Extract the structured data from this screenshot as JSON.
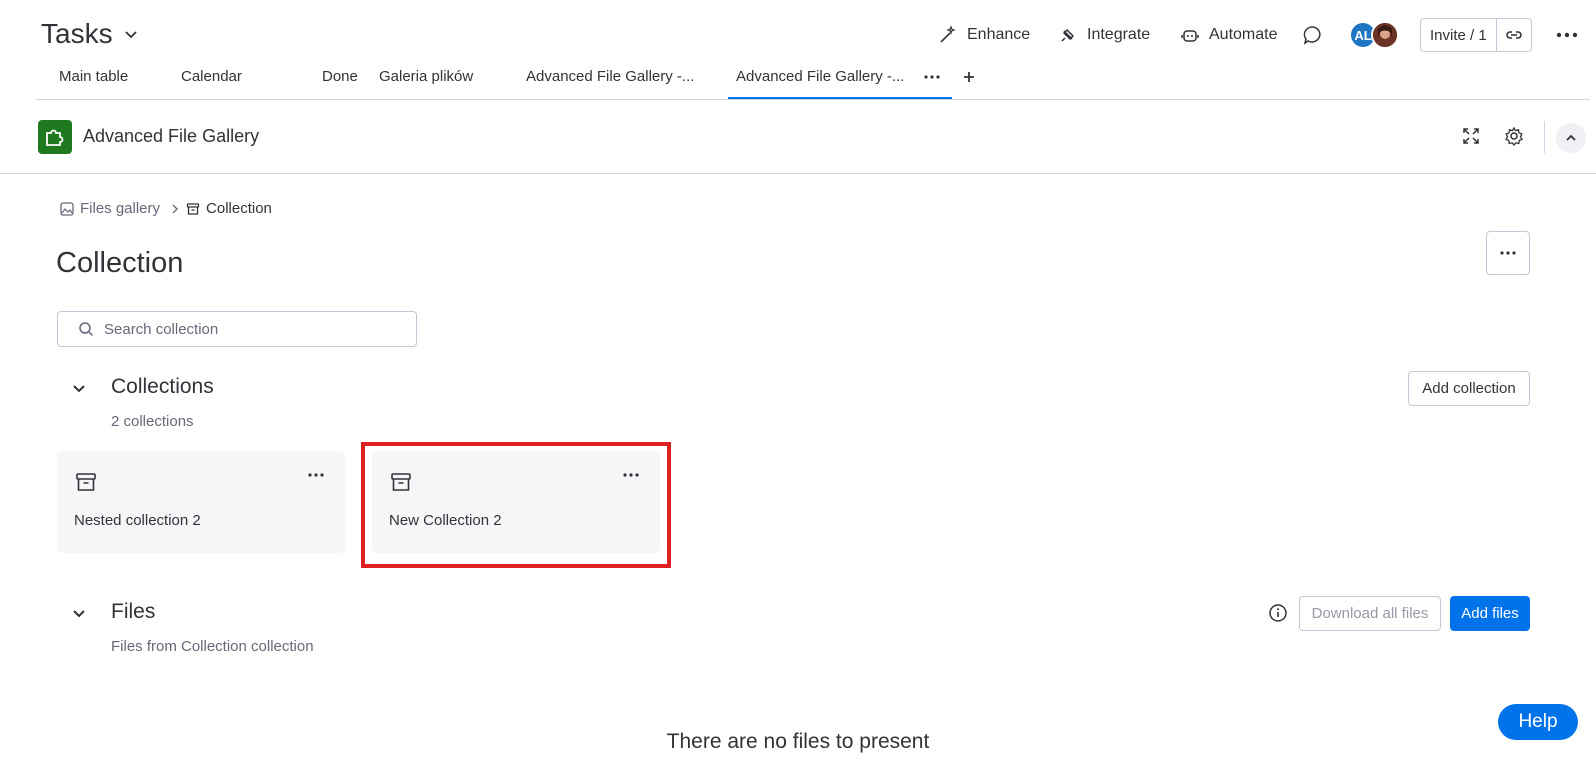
{
  "board": {
    "title": "Tasks"
  },
  "header": {
    "enhance": "Enhance",
    "integrate": "Integrate",
    "automate": "Automate",
    "avatar_initials": "AL",
    "invite_label": "Invite / 1"
  },
  "tabs": [
    {
      "label": "Main table"
    },
    {
      "label": "Calendar"
    },
    {
      "label": "Done"
    },
    {
      "label": "Galeria plików"
    },
    {
      "label": "Advanced File Gallery -..."
    },
    {
      "label": "Advanced File Gallery -...",
      "active": true
    }
  ],
  "app": {
    "name": "Advanced File Gallery"
  },
  "breadcrumb": {
    "root": "Files gallery",
    "current": "Collection"
  },
  "page": {
    "title": "Collection"
  },
  "search": {
    "placeholder": "Search collection"
  },
  "collections": {
    "title": "Collections",
    "subtitle": "2 collections",
    "add_button": "Add collection",
    "items": [
      {
        "name": "Nested collection 2"
      },
      {
        "name": "New Collection 2"
      }
    ]
  },
  "files": {
    "title": "Files",
    "subtitle": "Files from Collection collection",
    "download_button": "Download all files",
    "add_button": "Add files",
    "empty_message": "There are no files to present"
  },
  "help": {
    "label": "Help"
  },
  "colors": {
    "primary": "#0073ea",
    "app_icon": "#1f7a1f",
    "highlight": "#e02020"
  }
}
